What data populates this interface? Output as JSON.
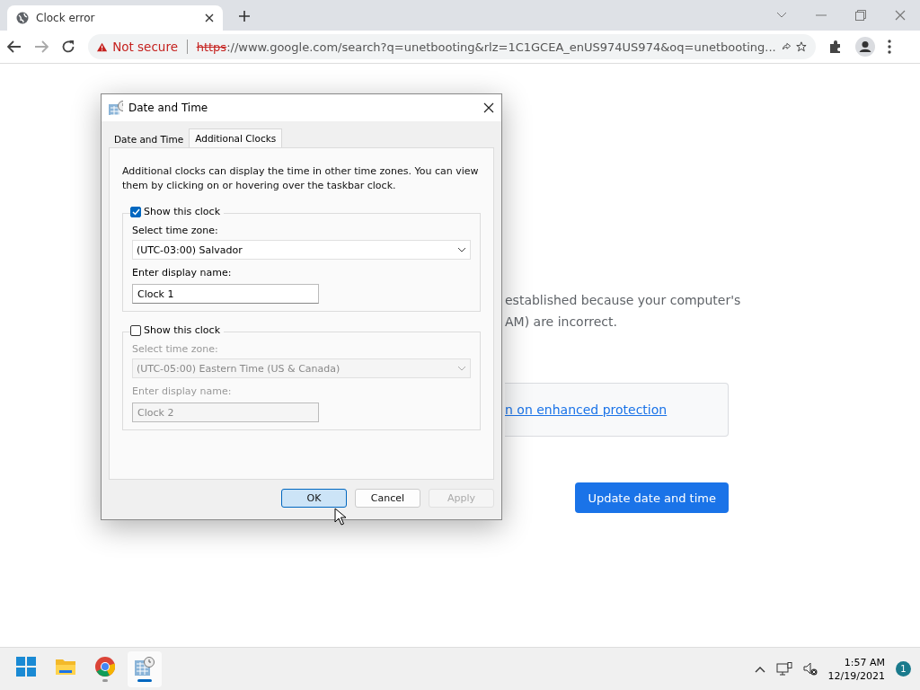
{
  "browser": {
    "tab": {
      "title": "Clock error"
    },
    "address": {
      "security": "Not secure",
      "scheme": "https",
      "rest": "://www.google.com/search?q=unetbooting&rlz=1C1GCEA_enUS974US974&oq=unetbooting..."
    }
  },
  "page": {
    "paragraph_lines": [
      "established because your computer's",
      "AM) are incorrect."
    ],
    "link": "n on enhanced protection",
    "button": "Update date and time"
  },
  "dialog": {
    "title": "Date and Time",
    "tabs": [
      {
        "label": "Date and Time",
        "selected": false
      },
      {
        "label": "Additional Clocks",
        "selected": true
      }
    ],
    "description": "Additional clocks can display the time in other time zones. You can view them by clicking on or hovering over the taskbar clock.",
    "clocks": [
      {
        "checked": true,
        "show_label": "Show this clock",
        "zone_label": "Select time zone:",
        "zone": "(UTC-03:00) Salvador",
        "name_label": "Enter display name:",
        "name": "Clock 1"
      },
      {
        "checked": false,
        "show_label": "Show this clock",
        "zone_label": "Select time zone:",
        "zone": "(UTC-05:00) Eastern Time (US & Canada)",
        "name_label": "Enter display name:",
        "name": "Clock 2"
      }
    ],
    "buttons": [
      {
        "label": "OK",
        "kind": "default",
        "disabled": false
      },
      {
        "label": "Cancel",
        "kind": "normal",
        "disabled": false
      },
      {
        "label": "Apply",
        "kind": "normal",
        "disabled": true
      }
    ]
  },
  "taskbar": {
    "apps": [
      {
        "kind": "start",
        "running": false,
        "active": false
      },
      {
        "kind": "files",
        "running": false,
        "active": false
      },
      {
        "kind": "browser",
        "running": true,
        "active": false
      },
      {
        "kind": "datetime",
        "running": true,
        "active": true
      }
    ],
    "time": "1:57 AM",
    "date": "12/19/2021",
    "notifications": "1"
  }
}
